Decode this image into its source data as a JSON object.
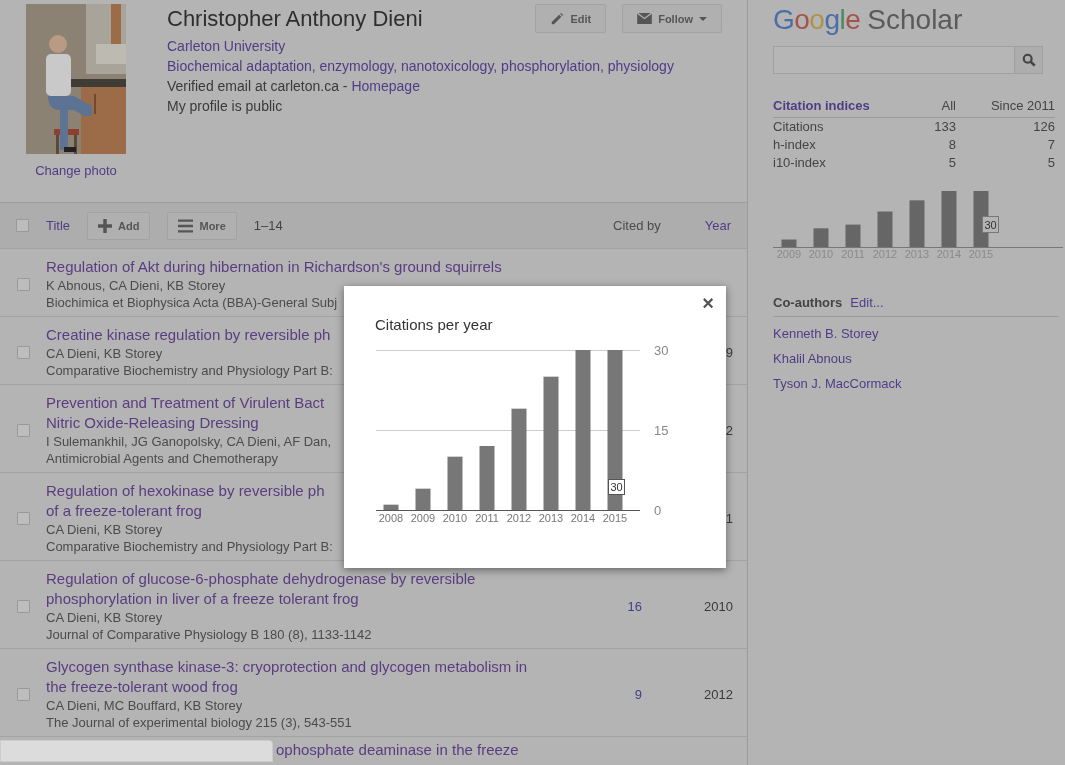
{
  "profile": {
    "change_photo": "Change photo",
    "name": "Christopher Anthony Dieni",
    "affiliation": "Carleton University",
    "interests": "Biochemical adaptation, enzymology, nanotoxicology, phosphorylation, physiology",
    "email": "Verified email at carleton.ca - ",
    "homepage": "Homepage",
    "visibility": "My profile is public"
  },
  "actions": [
    {
      "label": "Edit",
      "kind": "edit"
    },
    {
      "label": "Follow",
      "kind": "follow"
    }
  ],
  "toolbar": {
    "select_all_checked": false,
    "title": "Title",
    "add": "Add",
    "more": "More",
    "range": "1–14",
    "cited_by": "Cited by",
    "year": "Year"
  },
  "articles": [
    {
      "checked": false,
      "title_lines": [
        "Regulation of Akt during hibernation in Richardson's ground squirrels"
      ],
      "authors": "K Abnous, CA Dieni, KB Storey",
      "source": "Biochimica et Biophysica Acta (BBA)-General Subj"
    },
    {
      "checked": false,
      "title_lines": [
        "Creatine kinase regulation by reversible ph"
      ],
      "authors": "CA Dieni, KB Storey",
      "source": "Comparative Biochemistry and Physiology Part B:",
      "year": "9"
    },
    {
      "checked": false,
      "title_lines": [
        "Prevention and Treatment of Virulent Bact",
        "Nitric Oxide-Releasing Dressing"
      ],
      "authors": "I Sulemankhil, JG Ganopolsky, CA Dieni, AF Dan,",
      "source": "Antimicrobial Agents and Chemotherapy",
      "year": "2"
    },
    {
      "checked": false,
      "title_lines": [
        "Regulation of hexokinase by reversible ph",
        "of a freeze-tolerant frog"
      ],
      "authors": "CA Dieni, KB Storey",
      "source": "Comparative Biochemistry and Physiology Part B:",
      "year": "1"
    },
    {
      "checked": false,
      "title_lines": [
        "Regulation of glucose-6-phosphate dehydrogenase by reversible",
        "phosphorylation in liver of a freeze tolerant frog"
      ],
      "authors": "CA Dieni, KB Storey",
      "source": "Journal of Comparative Physiology B 180 (8), 1133-1142",
      "cited_by": "16",
      "year": "2010"
    },
    {
      "checked": false,
      "title_lines": [
        "Glycogen synthase kinase-3: cryoprotection and glycogen metabolism in",
        "the freeze-tolerant wood frog"
      ],
      "authors": "CA Dieni, MC Bouffard, KB Storey",
      "source": "The Journal of experimental biology 215 (3), 543-551",
      "cited_by": "9",
      "year": "2012"
    }
  ],
  "last_row": {
    "title": "ophosphate deaminase in the freeze"
  },
  "sidebar": {
    "logo": {
      "brand": "Google",
      "product": "Scholar"
    },
    "citation_indices": {
      "header": [
        "Citation indices",
        "All",
        "Since 2011"
      ],
      "rows": [
        {
          "label": "Citations",
          "all": "133",
          "since": "126"
        },
        {
          "label": "h-index",
          "all": "8",
          "since": "7"
        },
        {
          "label": "i10-index",
          "all": "5",
          "since": "5"
        }
      ]
    },
    "mini_chart": {
      "years": [
        "2009",
        "2010",
        "2011",
        "2012",
        "2013",
        "2014",
        "2015"
      ],
      "tooltip": "30"
    },
    "coauthors": {
      "title": "Co-authors",
      "edit": "Edit...",
      "people": [
        "Kenneth B. Storey",
        "Khalil Abnous",
        "Tyson J. MacCormack"
      ]
    }
  },
  "modal": {
    "close": "×",
    "chart_data": {
      "type": "bar",
      "title": "Citations per year",
      "categories": [
        "2008",
        "2009",
        "2010",
        "2011",
        "2012",
        "2013",
        "2014",
        "2015"
      ],
      "values": [
        1,
        4,
        10,
        12,
        19,
        25,
        30,
        30
      ],
      "ylim": [
        0,
        30
      ],
      "yticks": [
        0,
        15,
        30
      ],
      "annotations": [
        {
          "x": "2015",
          "text": "30"
        }
      ]
    }
  }
}
